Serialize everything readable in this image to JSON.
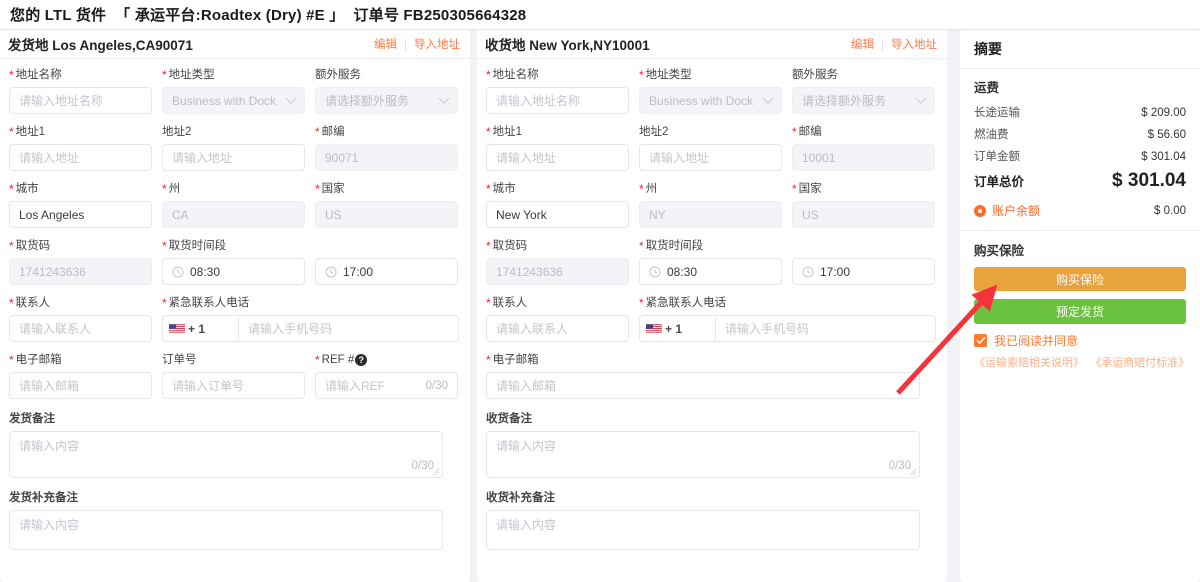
{
  "header": {
    "prefix": "您的 LTL 货件",
    "carrier": "「 承运平台:Roadtex (Dry) #E 」",
    "order_label": "订单号 FB250305664328"
  },
  "common": {
    "edit": "编辑",
    "import_address": "导入地址",
    "placeholder_address_name": "请输入地址名称",
    "placeholder_address": "请输入地址",
    "placeholder_extra_service": "请选择额外服务",
    "placeholder_contact": "请输入联系人",
    "placeholder_phone": "请输入手机号码",
    "placeholder_email": "请输入邮箱",
    "placeholder_order_no": "请输入订单号",
    "placeholder_ref": "请输入REF",
    "placeholder_content": "请输入内容",
    "counter_0_30": "0/30",
    "country_code": "+ 1",
    "labels": {
      "address_name": "地址名称",
      "address_type": "地址类型",
      "extra_service": "额外服务",
      "address1": "地址1",
      "address2": "地址2",
      "zip": "邮编",
      "city": "城市",
      "state": "州",
      "country": "国家",
      "pickup_code": "取货码",
      "pickup_window": "取货时间段",
      "contact": "联系人",
      "emergency_phone": "紧急联系人电话",
      "email": "电子邮箱",
      "order_no": "订单号",
      "ref": "REF #"
    }
  },
  "shipper": {
    "title_prefix": "发货地",
    "location": "Los Angeles,CA90071",
    "address_type": "Business with Dock",
    "zip": "90071",
    "city": "Los Angeles",
    "state": "CA",
    "country": "US",
    "pickup_code": "1741243636",
    "time_from": "08:30",
    "time_to": "17:00",
    "remark_label": "发货备注",
    "extra_remark_label": "发货补充备注"
  },
  "receiver": {
    "title_prefix": "收货地",
    "location": "New York,NY10001",
    "address_type": "Business with Dock",
    "zip": "10001",
    "city": "New York",
    "state": "NY",
    "country": "US",
    "pickup_code": "1741243636",
    "time_from": "08:30",
    "time_to": "17:00",
    "remark_label": "收货备注",
    "extra_remark_label": "收货补充备注"
  },
  "summary": {
    "title": "摘要",
    "freight_label": "运费",
    "lines": [
      {
        "label": "长途运输",
        "value": "$ 209.00"
      },
      {
        "label": "燃油费",
        "value": "$ 56.60"
      },
      {
        "label": "订单金额",
        "value": "$ 301.04"
      }
    ],
    "total_label": "订单总价",
    "total_value": "$ 301.04",
    "balance_label": "账户余额",
    "balance_value": "$ 0.00",
    "insurance_title": "购买保险",
    "buy_insurance_button": "购买保险",
    "book_button": "预定发货",
    "agree_text": "我已阅读并同意",
    "link1": "《运输索赔相关说明》",
    "link2": "《承运商赔付标准》"
  },
  "colors": {
    "accent_orange": "#ff7a2b",
    "insurance_button": "#e8a33d",
    "book_button": "#6bc23f",
    "required_star": "#f5222d",
    "arrow": "#f5333a"
  }
}
